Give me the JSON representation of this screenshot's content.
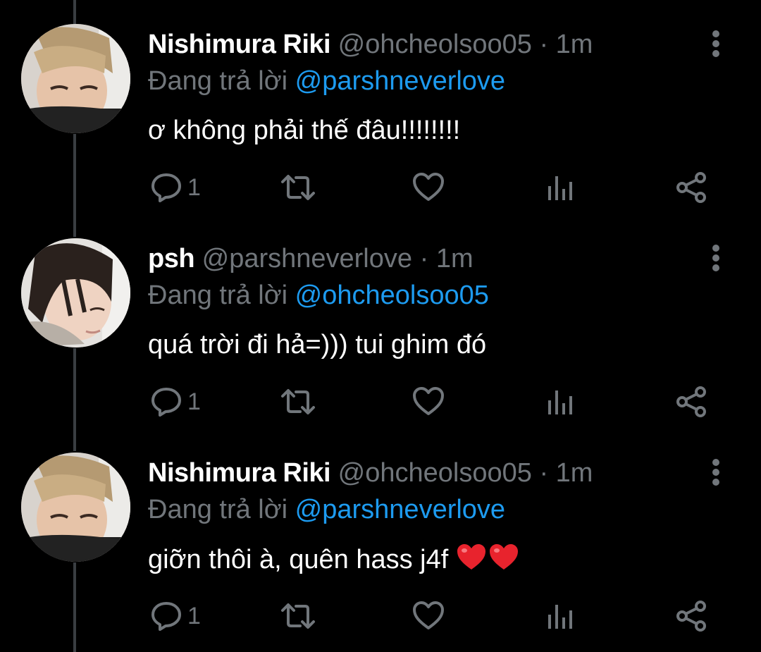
{
  "colors": {
    "background": "#000000",
    "text_primary": "#ffffff",
    "text_secondary": "#71767b",
    "mention": "#1d9bf0",
    "thread_line": "#3a3e42",
    "heart_emoji": "#e8232d"
  },
  "icons": {
    "reply": "speech-bubble-icon",
    "retweet": "retweet-icon",
    "like": "heart-icon",
    "views": "bar-chart-icon",
    "share": "share-icon",
    "more": "vertical-ellipsis-icon"
  },
  "tweets": [
    {
      "name": "Nishimura Riki",
      "handle": "@ohcheolsoo05",
      "separator": "·",
      "time": "1m",
      "reply_prefix": "Đang trả lời",
      "reply_to": "@parshneverlove",
      "text": "ơ không phải thế đâu!!!!!!!!",
      "reply_count": "1",
      "emoji": ""
    },
    {
      "name": "psh",
      "handle": "@parshneverlove",
      "separator": "·",
      "time": "1m",
      "reply_prefix": "Đang trả lời",
      "reply_to": "@ohcheolsoo05",
      "text": "quá trời đi hả=))) tui ghim đó",
      "reply_count": "1",
      "emoji": ""
    },
    {
      "name": "Nishimura Riki",
      "handle": "@ohcheolsoo05",
      "separator": "·",
      "time": "1m",
      "reply_prefix": "Đang trả lời",
      "reply_to": "@parshneverlove",
      "text": "giỡn thôi à, quên hass j4f ",
      "reply_count": "1",
      "emoji": "❤❤"
    }
  ]
}
